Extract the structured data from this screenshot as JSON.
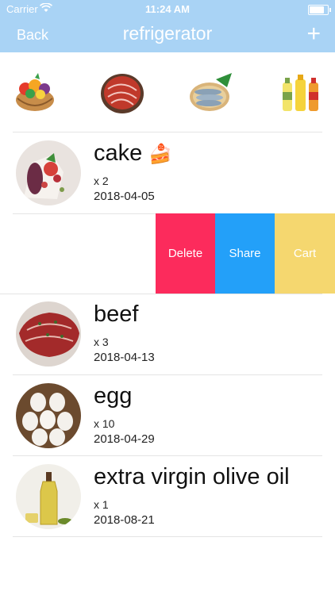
{
  "status_bar": {
    "carrier": "Carrier",
    "time": "11:24 AM",
    "battery_level": 0.9
  },
  "nav": {
    "back_label": "Back",
    "title": "refrigerator",
    "add_label": "+"
  },
  "categories": [
    {
      "name": "fruits-vegetables-icon"
    },
    {
      "name": "meat-icon"
    },
    {
      "name": "fish-icon"
    },
    {
      "name": "drinks-icon"
    }
  ],
  "items": [
    {
      "name": "cake",
      "emoji": "🍰",
      "quantity": "x 2",
      "date": "2018-04-05"
    },
    {
      "name": "beef",
      "emoji": "",
      "quantity": "x 3",
      "date": "2018-04-13"
    },
    {
      "name": "egg",
      "emoji": "",
      "quantity": "x 10",
      "date": "2018-04-29"
    },
    {
      "name": "extra virgin olive oil",
      "emoji": "",
      "quantity": "x 1",
      "date": "2018-08-21"
    }
  ],
  "swipe_actions": {
    "delete_label": "Delete",
    "share_label": "Share",
    "cart_label": "Cart",
    "delete_color": "#fc2b5c",
    "share_color": "#23a0f9",
    "cart_color": "#f5d76f"
  }
}
